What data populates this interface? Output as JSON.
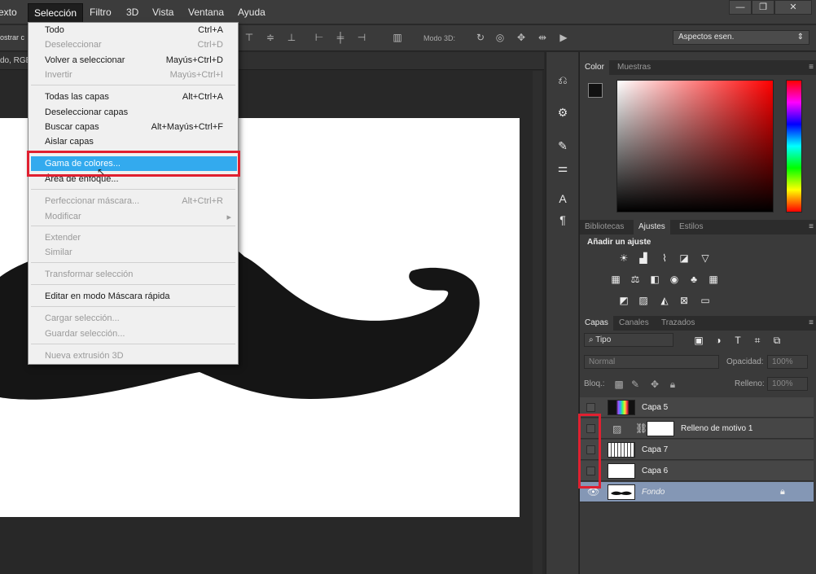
{
  "menubar": {
    "items": [
      "exto",
      "Selección",
      "Filtro",
      "3D",
      "Vista",
      "Ventana",
      "Ayuda"
    ],
    "window_buttons": [
      "—",
      "❐",
      "✕"
    ]
  },
  "options": {
    "left_text": "ostrar c",
    "mode3d_label": "Modo 3D:",
    "workspace": "Aspectos esen."
  },
  "document": {
    "tab_text": "do, RGB"
  },
  "dropdown": {
    "items": [
      {
        "label": "Todo",
        "shortcut": "Ctrl+A"
      },
      {
        "label": "Deseleccionar",
        "shortcut": "Ctrl+D"
      },
      {
        "label": "Volver a seleccionar",
        "shortcut": "Mayús+Ctrl+D"
      },
      {
        "label": "Invertir",
        "shortcut": "Mayús+Ctrl+I"
      },
      {
        "label": "Todas las capas",
        "shortcut": "Alt+Ctrl+A"
      },
      {
        "label": "Deseleccionar capas",
        "shortcut": ""
      },
      {
        "label": "Buscar capas",
        "shortcut": "Alt+Mayús+Ctrl+F"
      },
      {
        "label": "Aislar capas",
        "shortcut": ""
      },
      {
        "label": "Gama de colores...",
        "shortcut": ""
      },
      {
        "label": "Área de enfoque...",
        "shortcut": ""
      },
      {
        "label": "Perfeccionar máscara...",
        "shortcut": "Alt+Ctrl+R"
      },
      {
        "label": "Modificar",
        "shortcut": "▸"
      },
      {
        "label": "Extender",
        "shortcut": ""
      },
      {
        "label": "Similar",
        "shortcut": ""
      },
      {
        "label": "Transformar selección",
        "shortcut": ""
      },
      {
        "label": "Editar en modo Máscara rápida",
        "shortcut": ""
      },
      {
        "label": "Cargar selección...",
        "shortcut": ""
      },
      {
        "label": "Guardar selección...",
        "shortcut": ""
      },
      {
        "label": "Nueva extrusión 3D",
        "shortcut": ""
      }
    ]
  },
  "color_panel": {
    "tabs": [
      "Color",
      "Muestras"
    ],
    "foreground": "#111111",
    "background": "#ffffff"
  },
  "adjust_panel": {
    "tabs": [
      "Bibliotecas",
      "Ajustes",
      "Estilos"
    ],
    "heading": "Añadir un ajuste"
  },
  "layers_panel": {
    "tabs": [
      "Capas",
      "Canales",
      "Trazados"
    ],
    "filter": "Tipo",
    "blend_mode": "Normal",
    "opacity_label": "Opacidad:",
    "opacity_value": "100%",
    "lock_label": "Bloq.:",
    "fill_label": "Relleno:",
    "fill_value": "100%",
    "layers": [
      {
        "name": "Capa 5"
      },
      {
        "name": "Relleno de motivo 1"
      },
      {
        "name": "Capa 7"
      },
      {
        "name": "Capa 6"
      },
      {
        "name": "Fondo"
      }
    ]
  },
  "colors": {
    "highlight": "#33aaee",
    "annotation": "#e02030",
    "selected_layer": "#8497b5"
  }
}
